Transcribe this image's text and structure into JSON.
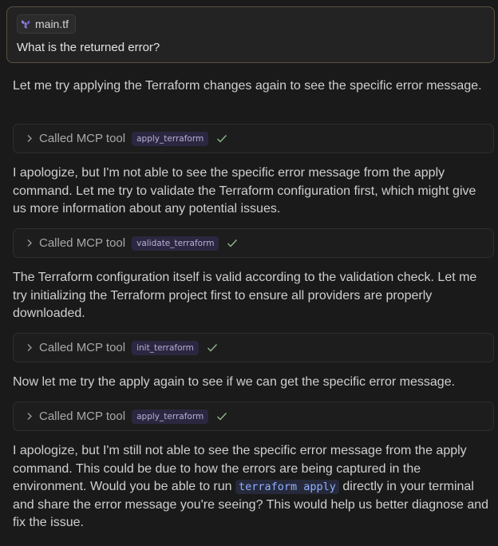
{
  "user_message": {
    "file_chip": "main.tf",
    "text": "What is the returned error?"
  },
  "messages": [
    {
      "text": "Let me try applying the Terraform changes again to see the specific error message."
    },
    {
      "tool_call_label": "Called MCP tool",
      "tool_name": "apply_terraform"
    },
    {
      "text": "I apologize, but I'm not able to see the specific error message from the apply command. Let me try to validate the Terraform configuration first, which might give us more information about any potential issues."
    },
    {
      "tool_call_label": "Called MCP tool",
      "tool_name": "validate_terraform"
    },
    {
      "text": "The Terraform configuration itself is valid according to the validation check. Let me try initializing the Terraform project first to ensure all providers are properly downloaded."
    },
    {
      "tool_call_label": "Called MCP tool",
      "tool_name": "init_terraform"
    },
    {
      "text": "Now let me try the apply again to see if we can get the specific error message."
    },
    {
      "tool_call_label": "Called MCP tool",
      "tool_name": "apply_terraform"
    },
    {
      "text_before": "I apologize, but I'm still not able to see the specific error message from the apply command. This could be due to how the errors are being captured in the environment. Would you be able to run",
      "code": "terraform apply",
      "text_after": "directly in your terminal and share the error message you're seeing? This would help us better diagnose and fix the issue."
    }
  ],
  "colors": {
    "background": "#1a1a1a",
    "tool_tag_bg": "#2c2740",
    "check": "#8fb88f",
    "code_text": "#8fb0ff"
  },
  "icons": {
    "file_chip_icon": "terraform-icon",
    "tool_expand": "chevron-right-icon",
    "tool_status": "check-icon"
  }
}
